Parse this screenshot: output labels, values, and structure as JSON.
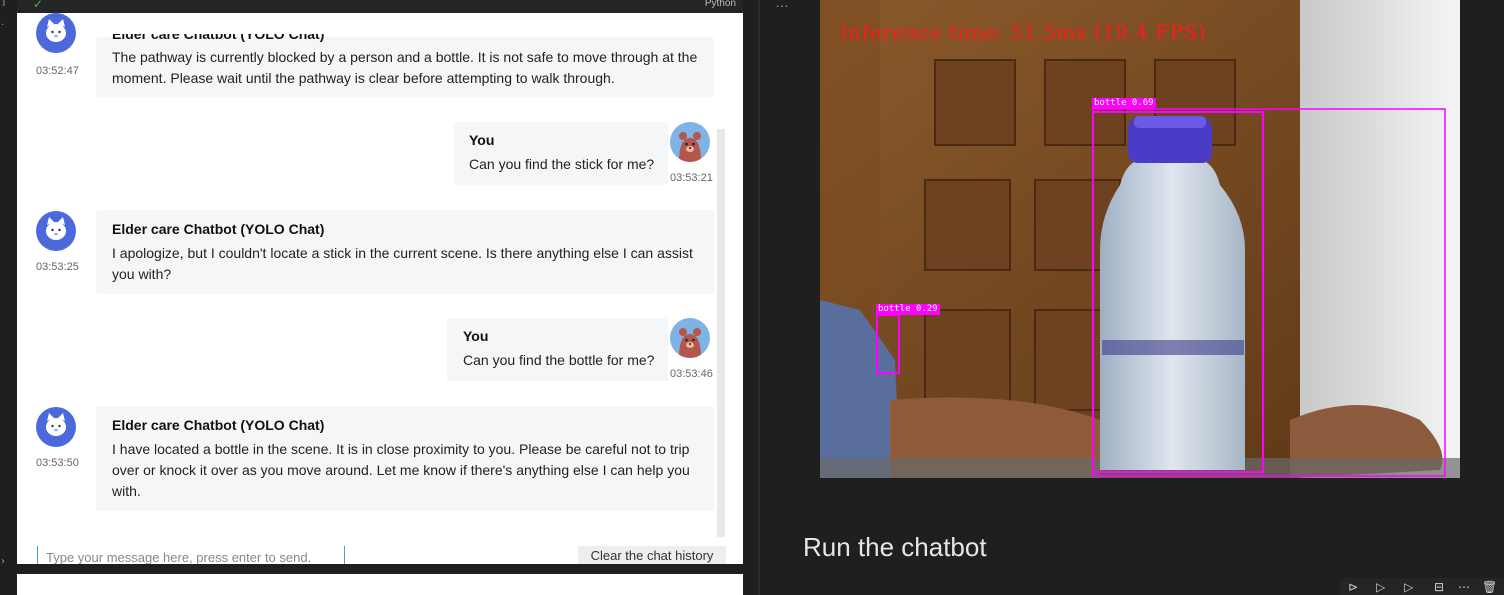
{
  "cell": {
    "language": "Python"
  },
  "chat": {
    "messages": [
      {
        "role": "bot",
        "sender": "Elder care Chatbot (YOLO Chat)",
        "time": "03:52:47",
        "lines": [
          "The pathway is currently blocked by a person and a bottle. It is not safe to move through at the",
          "moment. Please wait until the pathway is clear before attempting to walk through."
        ]
      },
      {
        "role": "user",
        "sender": "You",
        "time": "03:53:21",
        "lines": [
          "Can you find the stick for me?"
        ]
      },
      {
        "role": "bot",
        "sender": "Elder care Chatbot (YOLO Chat)",
        "time": "03:53:25",
        "lines": [
          "I apologize, but I couldn't locate a stick in the current scene. Is there anything else I can assist",
          "you with?"
        ]
      },
      {
        "role": "user",
        "sender": "You",
        "time": "03:53:46",
        "lines": [
          "Can you find the bottle for me?"
        ]
      },
      {
        "role": "bot",
        "sender": "Elder care Chatbot (YOLO Chat)",
        "time": "03:53:50",
        "lines": [
          "I have located a bottle in the scene. It is in close proximity to you. Please be careful not to trip",
          "over or knock it over as you move around. Let me know if there's anything else I can help you",
          "with."
        ]
      }
    ],
    "input_placeholder": "Type your message here, press enter to send.",
    "clear_label": "Clear the chat history"
  },
  "detection": {
    "inference_text": "Inference time: 51.5ms (19.4 FPS)",
    "labels": [
      "bottle 0.69",
      "bottle 0.29"
    ],
    "box_color": "#ff00ff"
  },
  "section_title": "Run the chatbot",
  "icons": [
    "check-icon",
    "more-icon",
    "bot-avatar",
    "user-avatar",
    "run-icon",
    "run-below-icon",
    "split-icon",
    "more-icon",
    "delete-icon"
  ]
}
